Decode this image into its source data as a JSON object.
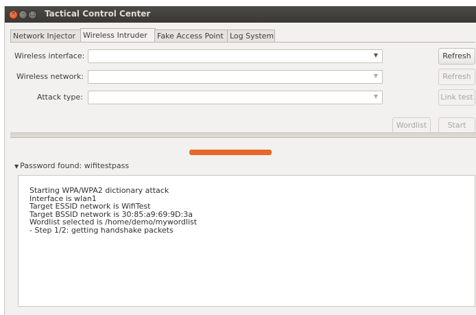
{
  "window": {
    "title": "Tactical Control Center"
  },
  "tabs": [
    {
      "label": "Network Injector",
      "active": false
    },
    {
      "label": "Wireless Intruder",
      "active": true
    },
    {
      "label": "Fake Access Point",
      "active": false
    },
    {
      "label": "Log System",
      "active": false
    }
  ],
  "form": {
    "interface_label": "Wireless interface:",
    "network_label": "Wireless network:",
    "attack_label": "Attack type:",
    "interface_value": "",
    "network_value": "",
    "attack_value": ""
  },
  "buttons": {
    "refresh_interfaces": "Refresh",
    "refresh_networks": "Refresh",
    "link_test": "Link test",
    "wordlist": "Wordlist",
    "start": "Start"
  },
  "expander": {
    "label": "Password found: wifitestpass",
    "expanded": true
  },
  "log": {
    "lines": [
      "Starting WPA/WPA2 dictionary attack",
      "Interface is wlan1",
      "Target ESSID network is WifiTest",
      "Target BSSID network is 30:85:a9:69:9D:3a",
      "Wordlist selected is /home/demo/mywordlist",
      "- Step 1/2: getting handshake packets"
    ]
  },
  "colors": {
    "accent": "#e8672a",
    "titlebar": "#3c3b37"
  }
}
